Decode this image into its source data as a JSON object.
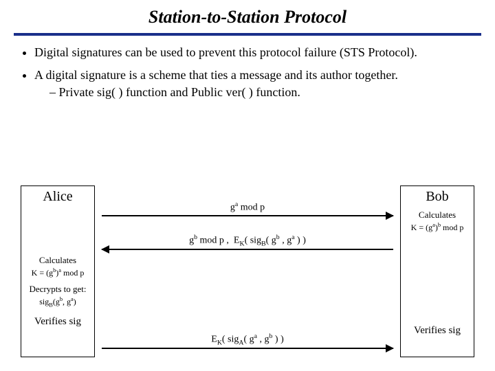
{
  "title": "Station-to-Station Protocol",
  "bullets": [
    {
      "text": "Digital signatures can be used to prevent this protocol failure (STS Protocol)."
    },
    {
      "text": "A digital signature is a scheme that ties a message and its author together.",
      "sub": "Private sig( ) function and Public ver( ) function."
    }
  ],
  "parties": {
    "alice": {
      "name": "Alice",
      "calc_label": "Calculates",
      "calc_eq": "K = (g^b)^a mod p",
      "decrypts_label": "Decrypts to get:",
      "decrypts_eq": "sig_B(g^b, g^a)",
      "verify": "Verifies sig"
    },
    "bob": {
      "name": "Bob",
      "calc_label": "Calculates",
      "calc_eq": "K = (g^a)^b mod p",
      "verify": "Verifies sig"
    }
  },
  "messages": {
    "m1": {
      "dir": "right",
      "label": "g^a mod p"
    },
    "m2": {
      "dir": "left",
      "label": "g^b mod p ,  E_K( sig_B( g^b , g^a ) )"
    },
    "m3": {
      "dir": "right",
      "label": "E_K( sig_A( g^a , g^b ) )"
    }
  }
}
